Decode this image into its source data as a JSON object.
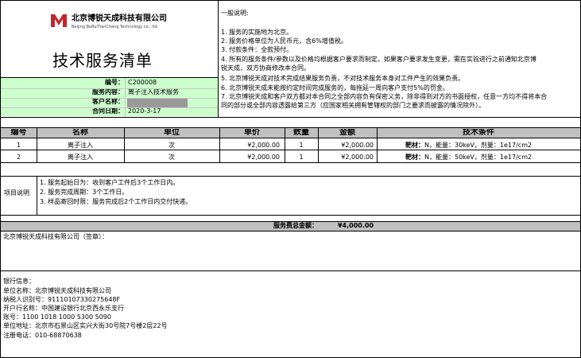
{
  "company": {
    "name_cn": "北京博锐天成科技有限公司",
    "name_en": "Beijing BoRuiTianCheng Technology co., ltd."
  },
  "title": "技术服务清单",
  "meta": {
    "no_label": "编号：",
    "no_value": "C200008",
    "service_label": "服务内容：",
    "service_value": "离子注入技术服务",
    "customer_label": "客户名称：",
    "customer_value": "",
    "date_label": "合同日期：",
    "date_value": "2020-3-17"
  },
  "notes": {
    "heading": "一般说明:",
    "items": [
      "1. 服务的实施地为北京。",
      "2. 服务价格单位为人民币元，含6%增值税。",
      "3. 付款条件：全款预付。",
      "4. 所有的服务条件/参数以及价格均根据客户要求而制定，如果客户要求发生变更，需在实验进行之前通知北京博",
      "锐天成，双方协商修改本合同。",
      "5. 北京博锐天成对技术完成结果服务负责，不对技术服务本身对工件产生的效果负责。",
      "6. 北京博锐天成未能按约定时间完成服务的，每拖延一周向客户支付5%的罚金。",
      "7. 北京博锐天成和客户双方都对本合同之全部内容负有保密义务，除非得到对方的书面授权，任意一方均不得将本合",
      "同的部分或全部内容透露给第三方（应国家相关拥有管辖权的部门之要求而披露的情况除外）。"
    ]
  },
  "table": {
    "headers": [
      "编号",
      "名称",
      "单位",
      "单价",
      "数量",
      "金额",
      "技术条件"
    ],
    "rows": [
      {
        "no": "1",
        "name": "离子注入",
        "unit": "次",
        "price": "¥2,000.00",
        "qty": "1",
        "amount": "¥2,000.00",
        "spec_pre": "靶材：",
        "spec_mid1": "N，能量：",
        "spec_energy": "30keV，",
        "spec_mid2": "剂量：",
        "spec_dose": "1e17/cm2"
      },
      {
        "no": "2",
        "name": "离子注入",
        "unit": "次",
        "price": "¥2,000.00",
        "qty": "1",
        "amount": "¥2,000.00",
        "spec_pre": "靶材：",
        "spec_mid1": "N，能量：",
        "spec_energy": "50keV，",
        "spec_mid2": "剂量：",
        "spec_dose": "1e17/cm2"
      }
    ]
  },
  "project": {
    "label": "项目说明",
    "lines": [
      "1. 服务起始日为：收到客户工件后3个工作日内。",
      "2. 服务完成周期：3个工作日。",
      "3. 样品寄回时限：服务完成后2个工作日内交付快递。"
    ]
  },
  "total": {
    "label": "服务费总金额：",
    "value": "¥4,000.00"
  },
  "sign": {
    "label": "北京博锐天成科技有限公司（签章）："
  },
  "bank": {
    "lines": [
      "银行信息：",
      "单位名称：北京博锐天成科技有限公司",
      "纳税人识别号：91110107330275648F",
      "开户行名称：中国建设银行北京西永乐支行",
      "账号：1100 1018 1000 5300 5090",
      "单位地址：北京市石景山区实兴大街30号院7号楼2层22号",
      "注册电话：010-68870638"
    ]
  },
  "colors": {
    "green": "#ccffcc",
    "grey": "#c0c0c0",
    "logo_red": "#c0272d"
  }
}
